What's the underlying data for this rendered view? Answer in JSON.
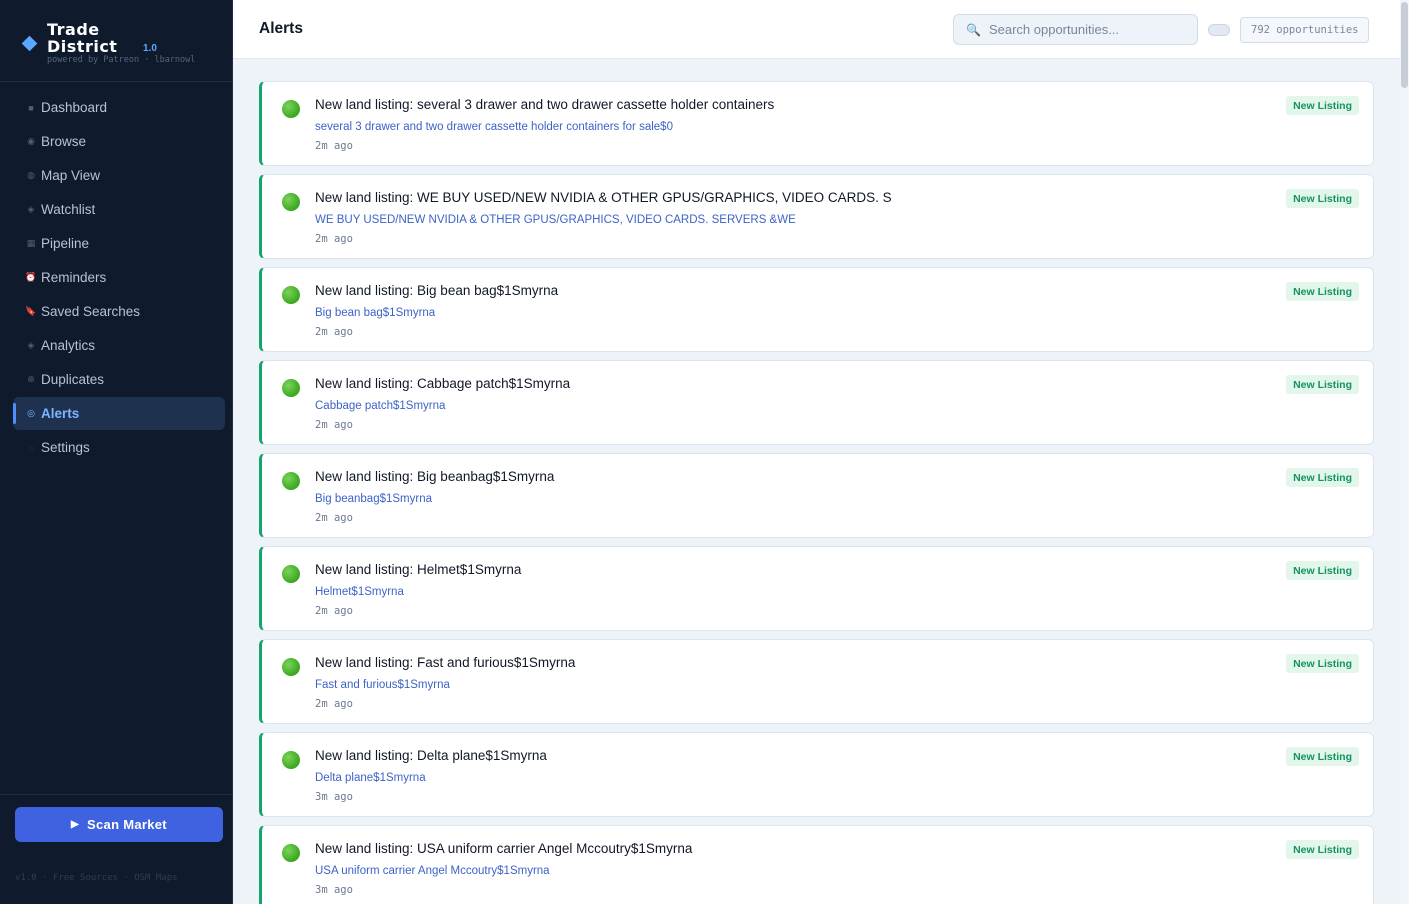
{
  "brand": {
    "name_line1": "Trade",
    "name_line2": "District",
    "version": "1.0",
    "powered_by": "powered by Patreon · lbarnowl"
  },
  "sidebar": {
    "items": [
      {
        "label": "Dashboard",
        "icon": "grid-square-icon",
        "glyph": "■"
      },
      {
        "label": "Browse",
        "icon": "circle-icon",
        "glyph": "◉"
      },
      {
        "label": "Map View",
        "icon": "globe-icon",
        "glyph": "◍"
      },
      {
        "label": "Watchlist",
        "icon": "diamond-icon",
        "glyph": "◈"
      },
      {
        "label": "Pipeline",
        "icon": "table-icon",
        "glyph": "▦"
      },
      {
        "label": "Reminders",
        "icon": "alarm-clock-icon",
        "glyph": "⏰"
      },
      {
        "label": "Saved Searches",
        "icon": "bookmark-icon",
        "glyph": "🔖"
      },
      {
        "label": "Analytics",
        "icon": "diamond-icon",
        "glyph": "◈"
      },
      {
        "label": "Duplicates",
        "icon": "plus-circle-icon",
        "glyph": "⊕"
      },
      {
        "label": "Alerts",
        "icon": "target-icon",
        "glyph": "◎"
      },
      {
        "label": "Settings",
        "icon": "gear-icon",
        "glyph": "◌"
      }
    ],
    "active_index": 9,
    "scan_button": "Scan Market",
    "footer": "v1.0 · Free Sources · OSM Maps"
  },
  "header": {
    "title": "Alerts",
    "search_placeholder": "Search opportunities...",
    "count": "792 opportunities"
  },
  "alerts": [
    {
      "title": "New land listing: several 3 drawer and two drawer cassette holder containers",
      "sub": "several 3 drawer and two drawer cassette holder containers for sale$0",
      "time": "2m ago",
      "badge": "New Listing"
    },
    {
      "title": "New land listing: WE BUY USED/NEW NVIDIA & OTHER GPUS/GRAPHICS, VIDEO CARDS. S",
      "sub": "WE BUY USED/NEW NVIDIA & OTHER GPUS/GRAPHICS, VIDEO CARDS. SERVERS &WE",
      "time": "2m ago",
      "badge": "New Listing"
    },
    {
      "title": "New land listing: Big bean bag$1Smyrna",
      "sub": "Big bean bag$1Smyrna",
      "time": "2m ago",
      "badge": "New Listing"
    },
    {
      "title": "New land listing: Cabbage patch$1Smyrna",
      "sub": "Cabbage patch$1Smyrna",
      "time": "2m ago",
      "badge": "New Listing"
    },
    {
      "title": "New land listing: Big beanbag$1Smyrna",
      "sub": "Big beanbag$1Smyrna",
      "time": "2m ago",
      "badge": "New Listing"
    },
    {
      "title": "New land listing: Helmet$1Smyrna",
      "sub": "Helmet$1Smyrna",
      "time": "2m ago",
      "badge": "New Listing"
    },
    {
      "title": "New land listing: Fast and furious$1Smyrna",
      "sub": "Fast and furious$1Smyrna",
      "time": "2m ago",
      "badge": "New Listing"
    },
    {
      "title": "New land listing: Delta plane$1Smyrna",
      "sub": "Delta plane$1Smyrna",
      "time": "3m ago",
      "badge": "New Listing"
    },
    {
      "title": "New land listing: USA uniform carrier Angel Mccoutry$1Smyrna",
      "sub": "USA uniform carrier Angel Mccoutry$1Smyrna",
      "time": "3m ago",
      "badge": "New Listing"
    }
  ],
  "colors": {
    "sidebar_bg": "#0f1b2d",
    "accent": "#3f63e0",
    "alert_border": "#15a46d",
    "badge_text": "#14935f",
    "link_text": "#3d63c7"
  }
}
